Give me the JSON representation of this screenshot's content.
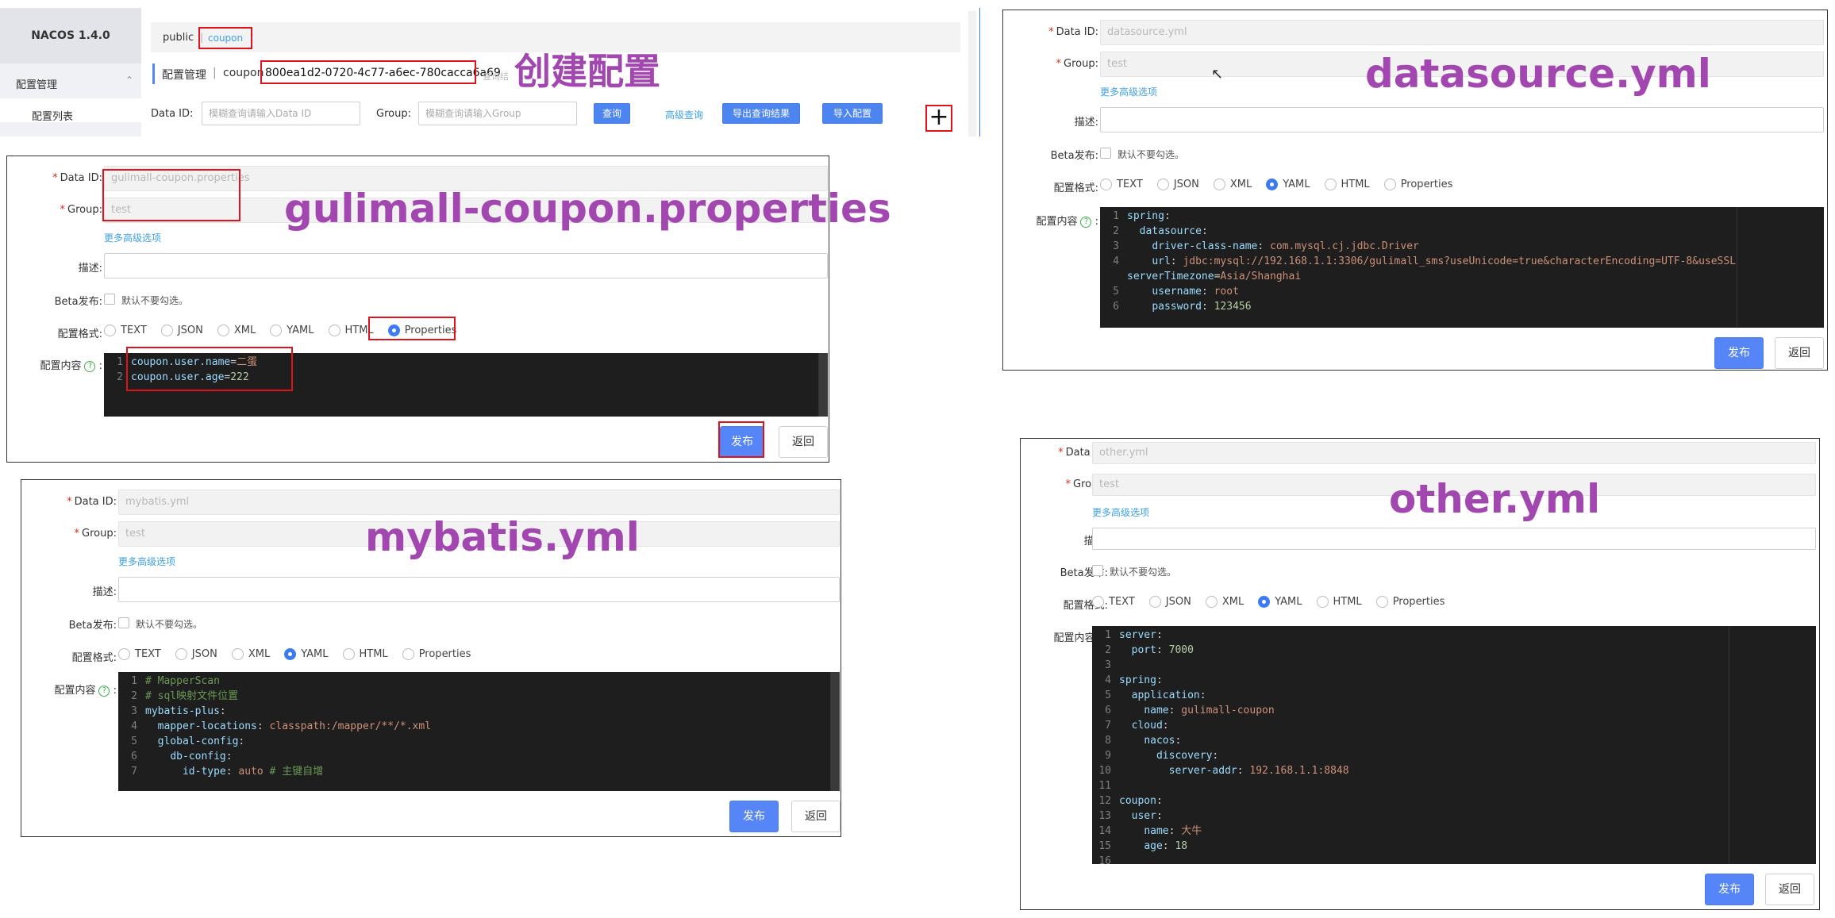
{
  "top": {
    "app_title": "NACOS 1.4.0",
    "menu_config_mgmt": "配置管理",
    "menu_config_list": "配置列表",
    "ns_public": "public",
    "ns_sep": "|",
    "ns_coupon": "coupon",
    "breadcrumb_title": "配置管理",
    "breadcrumb_sep": "|",
    "breadcrumb_ns": "coupon",
    "breadcrumb_id": "800ea1d2-0720-4c77-a6ec-780cacca6a69",
    "breadcrumb_tail": "查询结",
    "dataid_label": "Data ID:",
    "dataid_placeholder": "模糊查询请输入Data ID",
    "group_label": "Group:",
    "group_placeholder": "模糊查询请输入Group",
    "query_btn": "查询",
    "advanced_query": "高级查询",
    "export_btn": "导出查询结果",
    "import_btn": "导入配置",
    "add_glyph": "+"
  },
  "annotations": {
    "create": "创建配置",
    "props": "gulimall-coupon.properties",
    "datasource": "datasource.yml",
    "mybatis": "mybatis.yml",
    "other": "other.yml"
  },
  "labels": {
    "data_id": "Data ID:",
    "group": "Group:",
    "more_options": "更多高级选项",
    "desc": "描述:",
    "beta": "Beta发布:",
    "beta_hint": "默认不要勾选。",
    "format": "配置格式:",
    "content": "配置内容",
    "content_colon": ":",
    "help": "?",
    "required": "*",
    "publish": "发布",
    "back": "返回"
  },
  "formats": [
    "TEXT",
    "JSON",
    "XML",
    "YAML",
    "HTML",
    "Properties"
  ],
  "forms": {
    "props": {
      "data_id": "gulimall-coupon.properties",
      "group": "test",
      "selected_format": "Properties",
      "lines": [
        [
          "1",
          "coupon.user.name=二蛋"
        ],
        [
          "2",
          "coupon.user.age=222"
        ]
      ]
    },
    "datasource": {
      "data_id": "datasource.yml",
      "group": "test",
      "selected_format": "YAML",
      "lines": [
        [
          "1",
          "spring:"
        ],
        [
          "2",
          "  datasource:"
        ],
        [
          "3",
          "    driver-class-name: com.mysql.cj.jdbc.Driver"
        ],
        [
          "4",
          "    url: jdbc:mysql://192.168.1.1:3306/gulimall_sms?useUnicode=true&characterEncoding=UTF-8&useSSL"
        ],
        [
          "",
          "serverTimezone=Asia/Shanghai"
        ],
        [
          "5",
          "    username: root"
        ],
        [
          "6",
          "    password: 123456"
        ]
      ]
    },
    "mybatis": {
      "data_id": "mybatis.yml",
      "group": "test",
      "selected_format": "YAML",
      "lines": [
        [
          "1",
          "# MapperScan"
        ],
        [
          "2",
          "# sql映射文件位置"
        ],
        [
          "3",
          "mybatis-plus:"
        ],
        [
          "4",
          "  mapper-locations: classpath:/mapper/**/*.xml"
        ],
        [
          "5",
          "  global-config:"
        ],
        [
          "6",
          "    db-config:"
        ],
        [
          "7",
          "      id-type: auto # 主键自增"
        ]
      ]
    },
    "other": {
      "data_id": "other.yml",
      "group": "test",
      "selected_format": "YAML",
      "lines": [
        [
          "1",
          "server:"
        ],
        [
          "2",
          "  port: 7000"
        ],
        [
          "3",
          ""
        ],
        [
          "4",
          "spring:"
        ],
        [
          "5",
          "  application:"
        ],
        [
          "6",
          "    name: gulimall-coupon"
        ],
        [
          "7",
          "  cloud:"
        ],
        [
          "8",
          "    nacos:"
        ],
        [
          "9",
          "      discovery:"
        ],
        [
          "10",
          "        server-addr: 192.168.1.1:8848"
        ],
        [
          "11",
          ""
        ],
        [
          "12",
          "coupon:"
        ],
        [
          "13",
          "  user:"
        ],
        [
          "14",
          "    name: 大牛"
        ],
        [
          "15",
          "    age: 18"
        ],
        [
          "16",
          ""
        ]
      ]
    }
  },
  "colors": {
    "accent": "#5585f6",
    "annotation": "#a347b0",
    "highlight_box": "#e0121b",
    "editor_bg": "#1e1e1e"
  }
}
